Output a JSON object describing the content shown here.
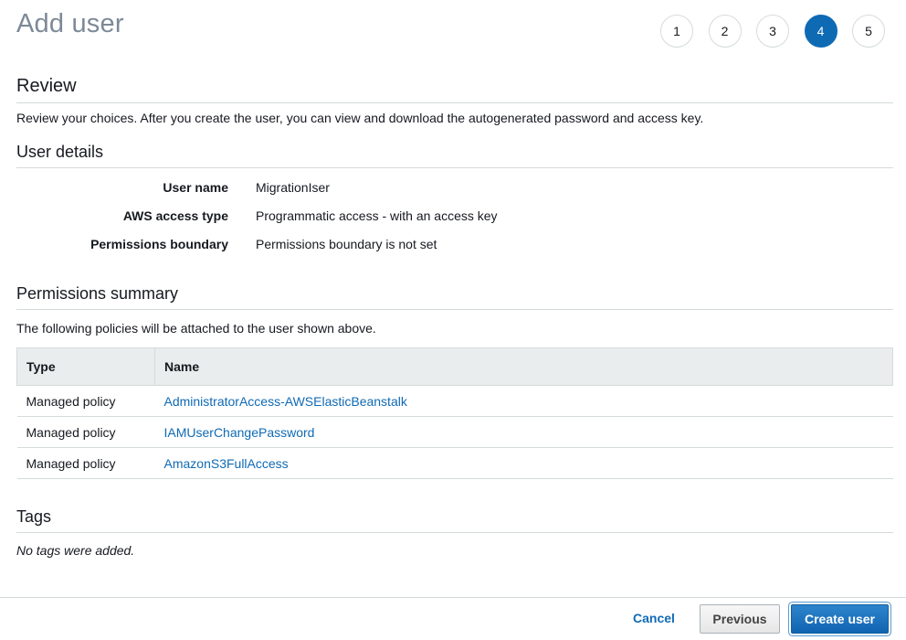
{
  "header": {
    "title": "Add user",
    "steps": [
      "1",
      "2",
      "3",
      "4",
      "5"
    ],
    "active_step": "4"
  },
  "review": {
    "heading": "Review",
    "description": "Review your choices. After you create the user, you can view and download the autogenerated password and access key."
  },
  "user_details": {
    "heading": "User details",
    "rows": [
      {
        "label": "User name",
        "value": "MigrationIser"
      },
      {
        "label": "AWS access type",
        "value": "Programmatic access - with an access key"
      },
      {
        "label": "Permissions boundary",
        "value": "Permissions boundary is not set"
      }
    ]
  },
  "permissions": {
    "heading": "Permissions summary",
    "description": "The following policies will be attached to the user shown above.",
    "columns": [
      "Type",
      "Name"
    ],
    "rows": [
      {
        "type": "Managed policy",
        "name": "AdministratorAccess-AWSElasticBeanstalk"
      },
      {
        "type": "Managed policy",
        "name": "IAMUserChangePassword"
      },
      {
        "type": "Managed policy",
        "name": "AmazonS3FullAccess"
      }
    ]
  },
  "tags": {
    "heading": "Tags",
    "empty_text": "No tags were added."
  },
  "footer": {
    "cancel_label": "Cancel",
    "previous_label": "Previous",
    "create_label": "Create user"
  },
  "colors": {
    "accent": "#0f6ab4",
    "title_gray": "#7d8998"
  }
}
